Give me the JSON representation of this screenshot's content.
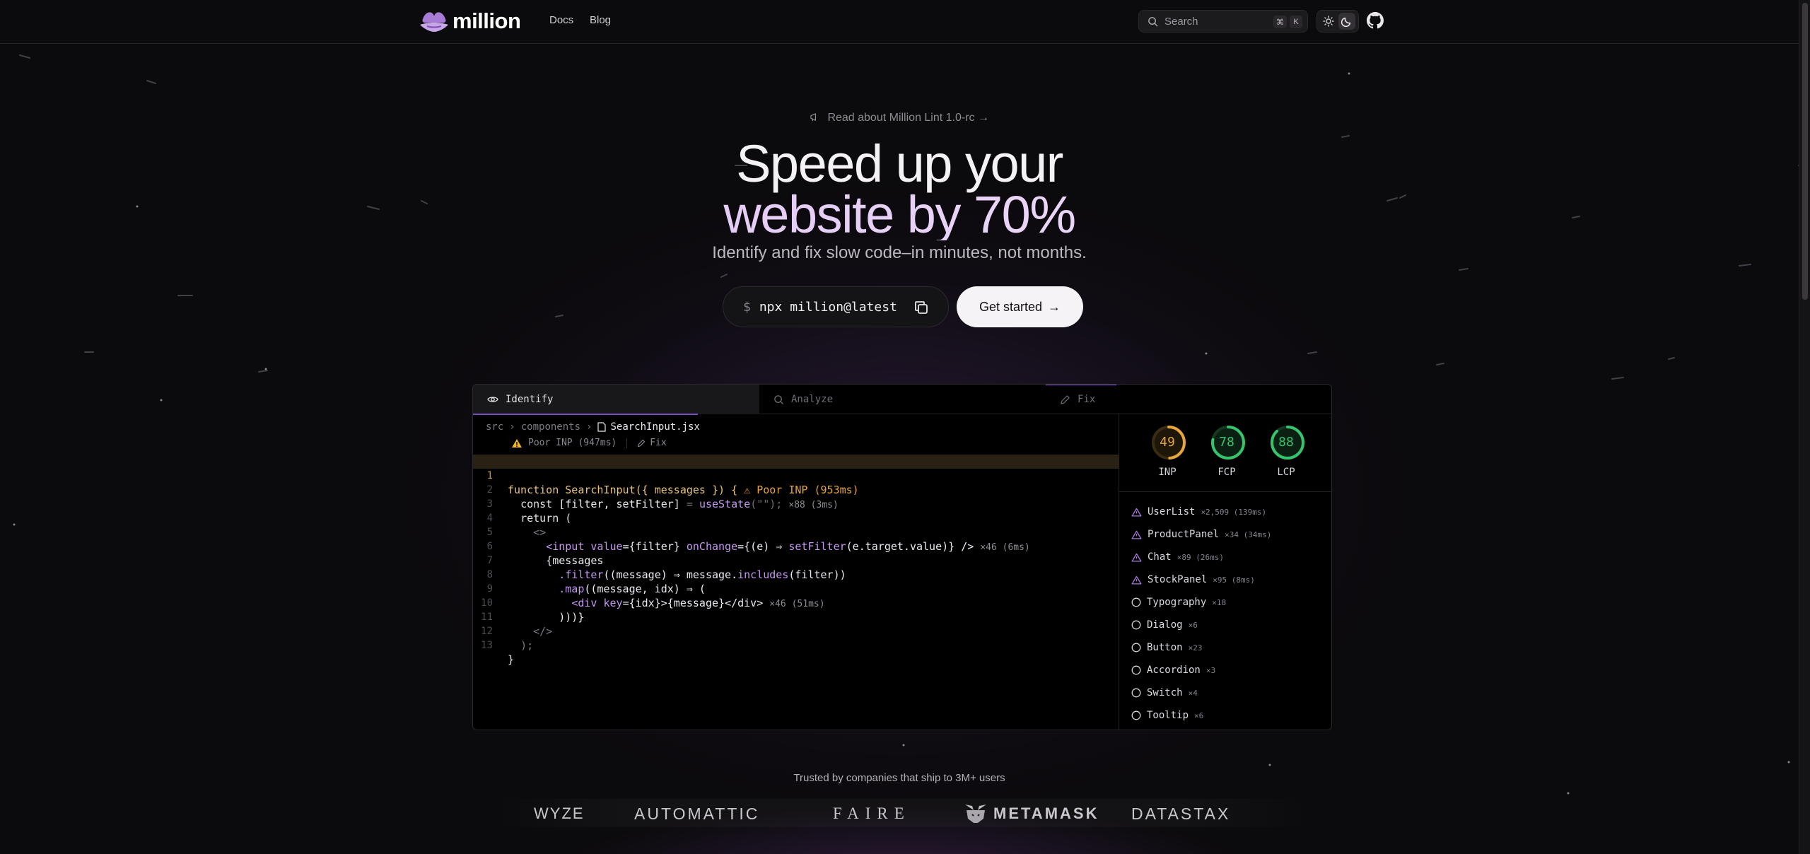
{
  "header": {
    "logo_text": "million",
    "nav": [
      {
        "label": "Docs"
      },
      {
        "label": "Blog"
      }
    ],
    "search": {
      "placeholder": "Search",
      "kbd_1": "⌘",
      "kbd_2": "K"
    },
    "theme": {
      "current": "dark"
    }
  },
  "hero": {
    "announcement": "Read about Million Lint 1.0-rc →",
    "title_line1": "Speed up your",
    "title_line2": "website by 70%",
    "subtitle": "Identify and fix slow code–in minutes, not months.",
    "command_prompt": "$",
    "command": "npx million@latest",
    "cta_label": "Get started",
    "cta_arrow": "→"
  },
  "demo": {
    "tabs": [
      {
        "label": "Identify",
        "icon": "eye-icon",
        "active": true
      },
      {
        "label": "Analyze",
        "icon": "search-icon",
        "active": false
      },
      {
        "label": "Fix",
        "icon": "pencil-icon",
        "active": false
      }
    ],
    "breadcrumb": {
      "root": "src",
      "folder": "components",
      "file": "SearchInput.jsx"
    },
    "warning": {
      "label": "Poor INP (947ms)",
      "fix_label": "Fix"
    },
    "code_lines": [
      {
        "n": "1"
      },
      {
        "n": "2"
      },
      {
        "n": "3"
      },
      {
        "n": "4"
      },
      {
        "n": "5"
      },
      {
        "n": "6"
      },
      {
        "n": "7"
      },
      {
        "n": "8"
      },
      {
        "n": "9"
      },
      {
        "n": "10"
      },
      {
        "n": "11"
      },
      {
        "n": "12"
      },
      {
        "n": "13"
      }
    ],
    "code": {
      "l1_kw": "function",
      "l1_fn": "SearchInput",
      "l1_args": "({ messages }) {",
      "l1_warn": "⚠ Poor INP (953ms)",
      "l2_a": "const",
      "l2_b": "[filter, setFilter]",
      "l2_c": "=",
      "l2_d": "useState",
      "l2_e": "(\"\");",
      "l2_meta": "×88 (3ms)",
      "l3": "return (",
      "l4": "<>",
      "l5_a": "<input",
      "l5_b": "value",
      "l5_c": "={filter}",
      "l5_d": "onChange",
      "l5_e": "={(e) ⇒",
      "l5_f": "setFilter",
      "l5_g": "(e.target.value)} />",
      "l5_meta": "×46 (6ms)",
      "l6": "{messages",
      "l7_a": ".filter",
      "l7_b": "((message) ⇒ message.",
      "l7_c": "includes",
      "l7_d": "(filter))",
      "l8_a": ".map",
      "l8_b": "((message, idx) ⇒ (",
      "l9_a": "<div",
      "l9_b": "key",
      "l9_c": "={idx}>{message}</div>",
      "l9_meta": "×46 (51ms)",
      "l10": ")))}",
      "l11": "</>",
      "l12": ");",
      "l13": "}"
    },
    "metrics": [
      {
        "label": "INP",
        "value": "49",
        "score": 0.49,
        "color": "#e8a53a"
      },
      {
        "label": "FCP",
        "value": "78",
        "score": 0.78,
        "color": "#35c46b"
      },
      {
        "label": "LCP",
        "value": "88",
        "score": 0.88,
        "color": "#35c46b"
      }
    ],
    "components": [
      {
        "name": "UserList",
        "count": "×2,509 (139ms)",
        "icon": "warning-triangle-icon"
      },
      {
        "name": "ProductPanel",
        "count": "×34 (34ms)",
        "icon": "warning-triangle-icon"
      },
      {
        "name": "Chat",
        "count": "×89 (26ms)",
        "icon": "warning-triangle-icon"
      },
      {
        "name": "StockPanel",
        "count": "×95 (8ms)",
        "icon": "warning-triangle-icon"
      },
      {
        "name": "Typography",
        "count": "×18",
        "icon": "circle-icon"
      },
      {
        "name": "Dialog",
        "count": "×6",
        "icon": "circle-icon"
      },
      {
        "name": "Button",
        "count": "×23",
        "icon": "circle-icon"
      },
      {
        "name": "Accordion",
        "count": "×3",
        "icon": "circle-icon"
      },
      {
        "name": "Switch",
        "count": "×4",
        "icon": "circle-icon"
      },
      {
        "name": "Tooltip",
        "count": "×6",
        "icon": "circle-icon"
      }
    ]
  },
  "trusted": {
    "heading": "Trusted by companies that ship to 3M+ users",
    "brands": [
      "WYZE",
      "AUTOMATTIC",
      "FAIRE",
      "METAMASK",
      "DATASTAX"
    ]
  },
  "colors": {
    "accent": "#8b5fd0",
    "warning": "#e8a53a",
    "good": "#35c46b"
  }
}
